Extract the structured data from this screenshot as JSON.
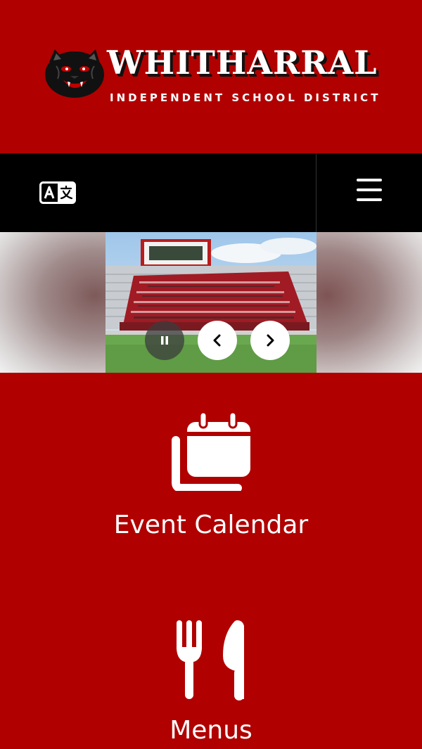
{
  "header": {
    "logo_title": "WHITHARRAL",
    "logo_subtitle": "INDEPENDENT SCHOOL DISTRICT",
    "logo_mascot_icon": "panther-head-icon"
  },
  "navbar": {
    "translate_icon": "translate-icon",
    "menu_icon": "hamburger-menu-icon"
  },
  "slideshow": {
    "pause_icon": "pause-icon",
    "prev_icon": "chevron-left-icon",
    "next_icon": "chevron-right-icon"
  },
  "quicklinks": [
    {
      "label": "Event Calendar",
      "icon": "calendar-icon"
    },
    {
      "label": "Menus",
      "icon": "fork-knife-icon"
    }
  ],
  "colors": {
    "brand_red": "#b00000",
    "nav_black": "#000000",
    "text_white": "#ffffff"
  }
}
